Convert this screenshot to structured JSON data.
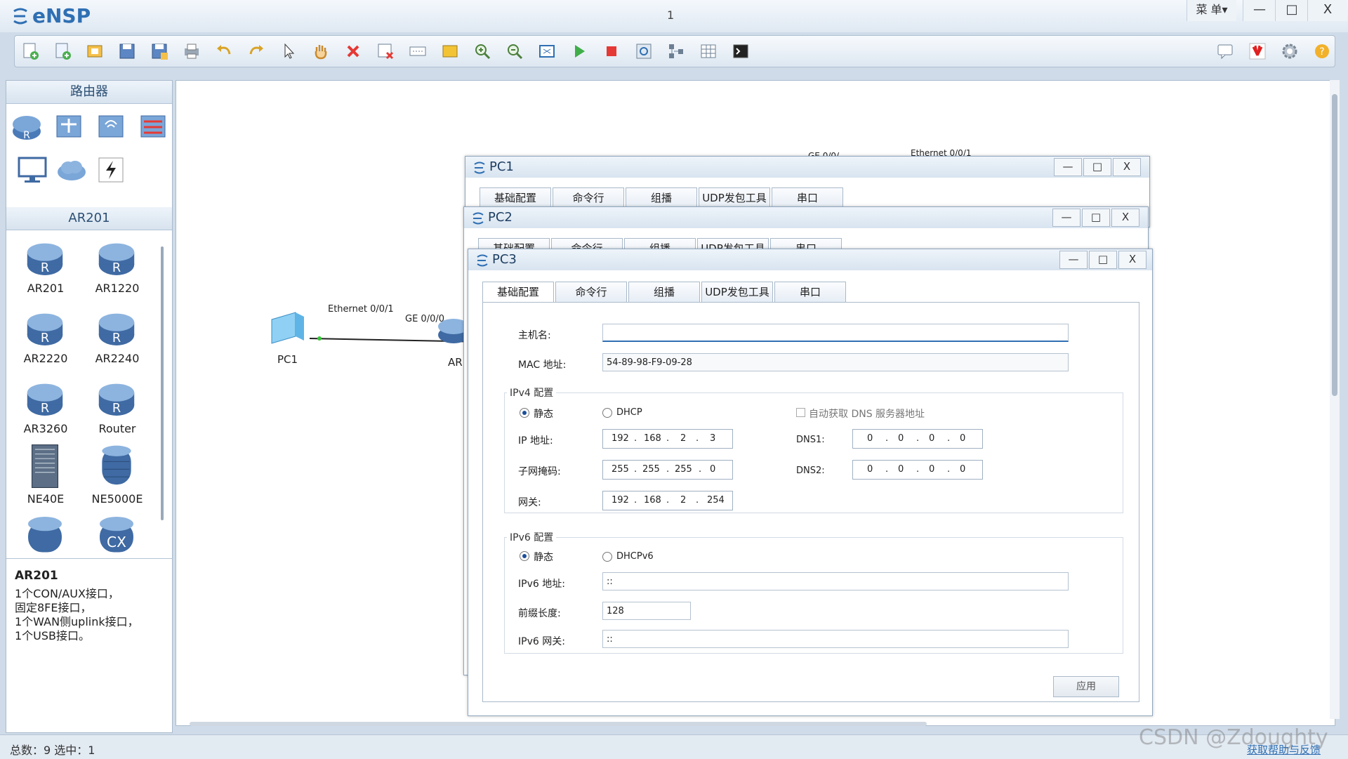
{
  "app": {
    "title": "eNSP",
    "center_number": "1",
    "menu_label": "菜 单▾",
    "minimize": "—",
    "maximize": "□",
    "close": "X"
  },
  "toolbar": {
    "icons": [
      "new-topology-icon",
      "new-example-icon",
      "open-icon",
      "save-icon",
      "save-as-icon",
      "print-icon",
      "undo-icon",
      "redo-icon",
      "select-pointer-icon",
      "hand-drag-icon",
      "delete-icon",
      "delete-link-icon",
      "text-annotation-icon",
      "palette-icon",
      "zoom-in-icon",
      "zoom-out-icon",
      "fit-window-icon",
      "start-device-icon",
      "stop-device-icon",
      "capture-icon",
      "topology-icon",
      "grid-icon",
      "console-icon"
    ],
    "right_icons": [
      "chat-icon",
      "huawei-icon",
      "settings-icon",
      "help-icon"
    ]
  },
  "left_panel": {
    "router_header": "路由器",
    "sub_header": "AR201",
    "devices": [
      {
        "label": "AR201"
      },
      {
        "label": "AR1220"
      },
      {
        "label": "AR2220"
      },
      {
        "label": "AR2240"
      },
      {
        "label": "AR3260"
      },
      {
        "label": "Router"
      },
      {
        "label": "NE40E"
      },
      {
        "label": "NE5000E"
      }
    ],
    "description": {
      "title": "AR201",
      "lines": [
        "1个CON/AUX接口，",
        "固定8FE接口，",
        "1个WAN侧uplink接口，",
        "1个USB接口。"
      ]
    }
  },
  "canvas": {
    "pc_label": "PC1",
    "link_label_1": "Ethernet 0/0/1",
    "link_label_2": "GE 0/0/0",
    "router_label_partial": "AR",
    "top_link_label": "Ethernet 0/0/1",
    "top_link_label_2": "GE 0/0/"
  },
  "dialogs": {
    "pc1": {
      "title": "PC1"
    },
    "pc2": {
      "title": "PC2"
    },
    "pc3": {
      "title": "PC3",
      "tabs": [
        "基础配置",
        "命令行",
        "组播",
        "UDP发包工具",
        "串口"
      ],
      "hostname_label": "主机名:",
      "hostname_value": "",
      "mac_label": "MAC 地址:",
      "mac_value": "54-89-98-F9-09-28",
      "ipv4_group": "IPv4 配置",
      "static_label": "静态",
      "dhcp_label": "DHCP",
      "auto_dns_label": "自动获取 DNS 服务器地址",
      "ip_label": "IP 地址:",
      "ip_value": [
        "192",
        "168",
        "2",
        "3"
      ],
      "mask_label": "子网掩码:",
      "mask_value": [
        "255",
        "255",
        "255",
        "0"
      ],
      "gw_label": "网关:",
      "gw_value": [
        "192",
        "168",
        "2",
        "254"
      ],
      "dns1_label": "DNS1:",
      "dns1_value": [
        "0",
        "0",
        "0",
        "0"
      ],
      "dns2_label": "DNS2:",
      "dns2_value": [
        "0",
        "0",
        "0",
        "0"
      ],
      "ipv6_group": "IPv6 配置",
      "static6_label": "静态",
      "dhcpv6_label": "DHCPv6",
      "ipv6_addr_label": "IPv6 地址:",
      "ipv6_addr_value": "::",
      "prefix_label": "前缀长度:",
      "prefix_value": "128",
      "ipv6_gw_label": "IPv6 网关:",
      "ipv6_gw_value": "::",
      "apply_label": "应用"
    }
  },
  "status": {
    "text": "总数：9 选中：1",
    "help_link": "获取帮助与反馈",
    "watermark": "CSDN @Zdoughty"
  },
  "colors": {
    "accent": "#2f6fb3",
    "title_text": "#1f3f63",
    "radio_on": "#1b4f9c"
  }
}
